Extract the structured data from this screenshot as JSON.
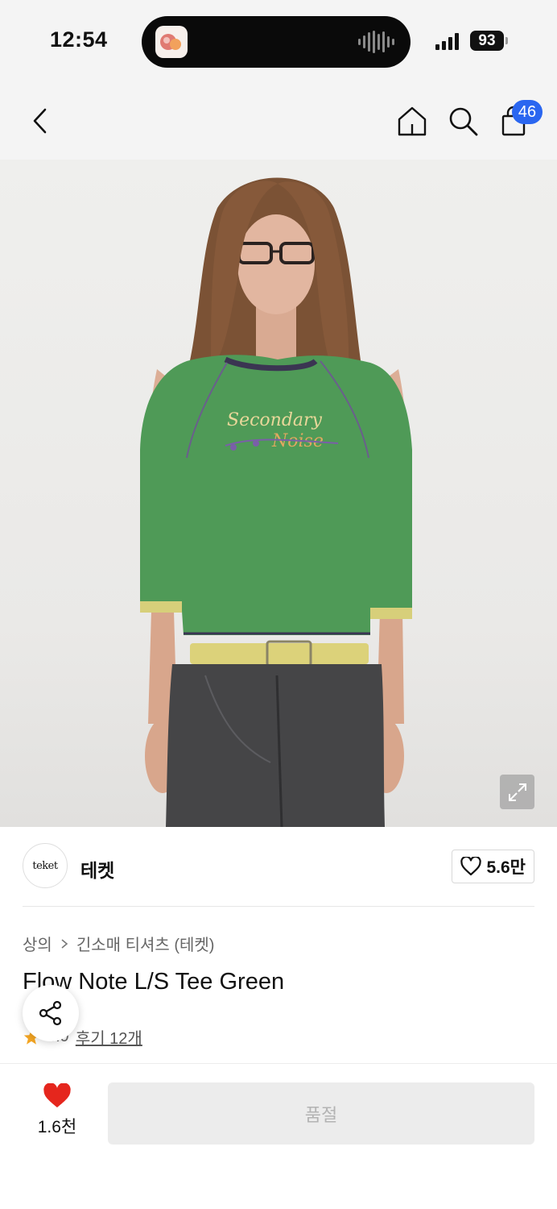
{
  "status_bar": {
    "time": "12:54",
    "battery": "93"
  },
  "nav": {
    "cart_count": "46"
  },
  "brand": {
    "logo_text": "teket",
    "name": "테켓",
    "likes": "5.6만"
  },
  "breadcrumb": {
    "level1": "상의",
    "level2": "긴소매 티셔츠 (테켓)"
  },
  "product": {
    "title": "Flow Note L/S Tee Green",
    "rating": "4.9",
    "review_link": "후기 12개",
    "print_line1": "Secondary",
    "print_line2": "Noise"
  },
  "bottom": {
    "wish_count": "1.6천",
    "buy_label": "품절"
  },
  "colors": {
    "accent_blue": "#2a66f0",
    "heart_red": "#e5261d",
    "star": "#f5a623",
    "shirt_green": "#4f9a57"
  }
}
